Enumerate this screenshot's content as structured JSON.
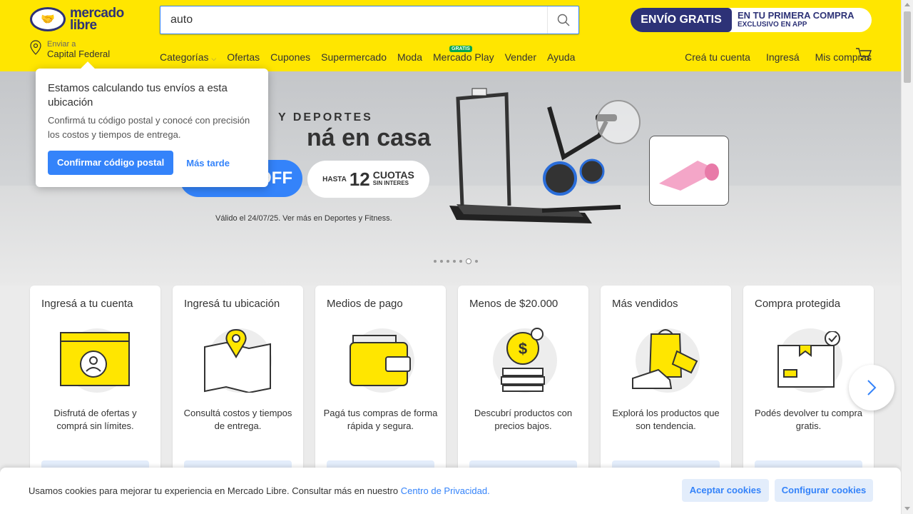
{
  "header": {
    "logo_line1": "mercado",
    "logo_line2": "libre",
    "search": {
      "value": "auto",
      "placeholder": ""
    },
    "promo": {
      "badge": "ENVÍO GRATIS",
      "line1": "EN TU PRIMERA COMPRA",
      "line2": "EXCLUSIVO EN APP"
    },
    "location": {
      "label": "Enviar a",
      "value": "Capital Federal"
    },
    "nav": [
      "Categorías",
      "Ofertas",
      "Cupones",
      "Supermercado",
      "Moda",
      "Mercado Play",
      "Vender",
      "Ayuda"
    ],
    "nav_badge": "GRATIS",
    "user_nav": [
      "Creá tu cuenta",
      "Ingresá",
      "Mis compras"
    ]
  },
  "hero": {
    "subtitle": "Y DEPORTES",
    "title": "ná en casa",
    "discount": "OFF",
    "cuotas_prefix": "HASTA",
    "cuotas_number": "12",
    "cuotas_word": "CUOTAS",
    "cuotas_suffix": "SIN INTERES",
    "validity": "Válido el 24/07/25. Ver más en Deportes y Fitness.",
    "slides_total": 7,
    "active_slide": 6
  },
  "popup": {
    "title": "Estamos calculando tus envíos a esta ubicación",
    "body": "Confirmá tu código postal y conocé con precisión los costos y tiempos de entrega.",
    "primary": "Confirmar código postal",
    "secondary": "Más tarde"
  },
  "cards": [
    {
      "title": "Ingresá a tu cuenta",
      "desc": "Disfrutá de ofertas y comprá sin límites.",
      "icon": "account-icon"
    },
    {
      "title": "Ingresá tu ubicación",
      "desc": "Consultá costos y tiempos de entrega.",
      "icon": "location-map-icon"
    },
    {
      "title": "Medios de pago",
      "desc": "Pagá tus compras de forma rápida y segura.",
      "icon": "wallet-icon"
    },
    {
      "title": "Menos de $20.000",
      "desc": "Descubrí productos con precios bajos.",
      "icon": "coins-icon"
    },
    {
      "title": "Más vendidos",
      "desc": "Explorá los productos que son tendencia.",
      "icon": "best-sellers-icon"
    },
    {
      "title": "Compra protegida",
      "desc": "Podés devolver tu compra gratis.",
      "icon": "protected-box-icon"
    }
  ],
  "cookie": {
    "text": "Usamos cookies para mejorar tu experiencia en Mercado Libre. Consultar más en nuestro ",
    "link": "Centro de Privacidad.",
    "accept": "Aceptar cookies",
    "configure": "Configurar cookies"
  },
  "colors": {
    "brand_yellow": "#ffe600",
    "brand_navy": "#2d3277",
    "accent_blue": "#3483fa"
  }
}
